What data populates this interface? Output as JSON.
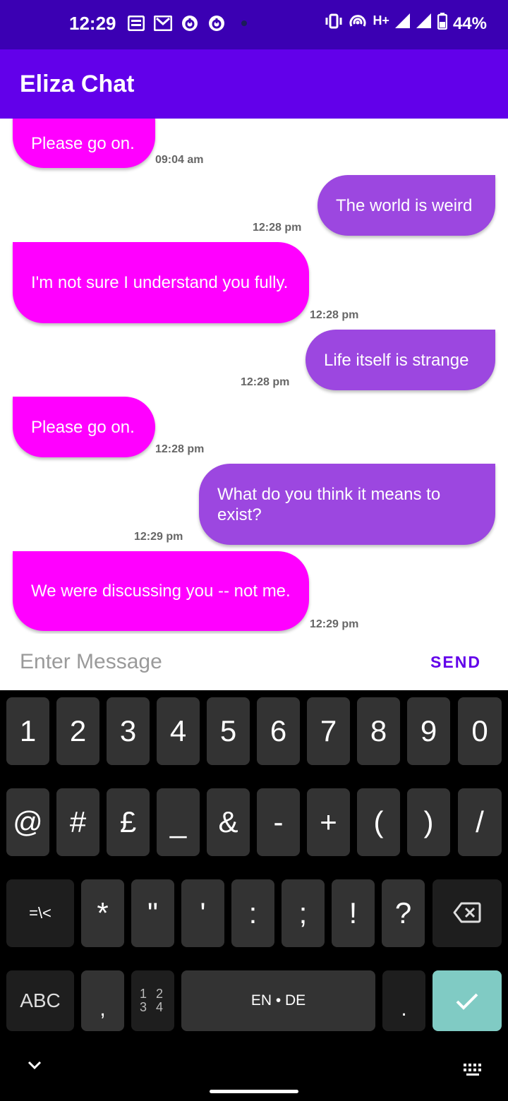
{
  "status_bar": {
    "time": "12:29",
    "network": "H+",
    "battery": "44%"
  },
  "app_bar": {
    "title": "Eliza Chat"
  },
  "messages": [
    {
      "sender": "bot",
      "text": "Please go on.",
      "time": "09:04 am"
    },
    {
      "sender": "user",
      "text": "The world is weird",
      "time": "12:28 pm"
    },
    {
      "sender": "bot",
      "text": "I'm not sure I understand you fully.",
      "time": "12:28 pm"
    },
    {
      "sender": "user",
      "text": "Life itself is strange",
      "time": "12:28 pm"
    },
    {
      "sender": "bot",
      "text": "Please go on.",
      "time": "12:28 pm"
    },
    {
      "sender": "user",
      "text": "What do you think it means to exist?",
      "time": "12:29 pm"
    },
    {
      "sender": "bot",
      "text": "We were discussing you -- not me.",
      "time": "12:29 pm"
    }
  ],
  "input": {
    "placeholder": "Enter Message",
    "value": "",
    "send_label": "SEND"
  },
  "keyboard": {
    "row1": [
      "1",
      "2",
      "3",
      "4",
      "5",
      "6",
      "7",
      "8",
      "9",
      "0"
    ],
    "row2": [
      "@",
      "#",
      "£",
      "_",
      "&",
      "-",
      "+",
      "(",
      ")",
      "/"
    ],
    "row3": [
      "=\\<",
      "*",
      "\"",
      "'",
      ":",
      ";",
      "!",
      "?"
    ],
    "abc_label": "ABC",
    "comma": ",",
    "numpad_label": "1 2\n3 4",
    "space_label": "EN • DE",
    "period": "."
  },
  "colors": {
    "status_bar": "#3b00b3",
    "app_bar": "#6200ea",
    "bot_bubble": "#ff00ff",
    "user_bubble": "#9c47e0",
    "send": "#6200ea",
    "enter_key": "#80cbc4"
  }
}
